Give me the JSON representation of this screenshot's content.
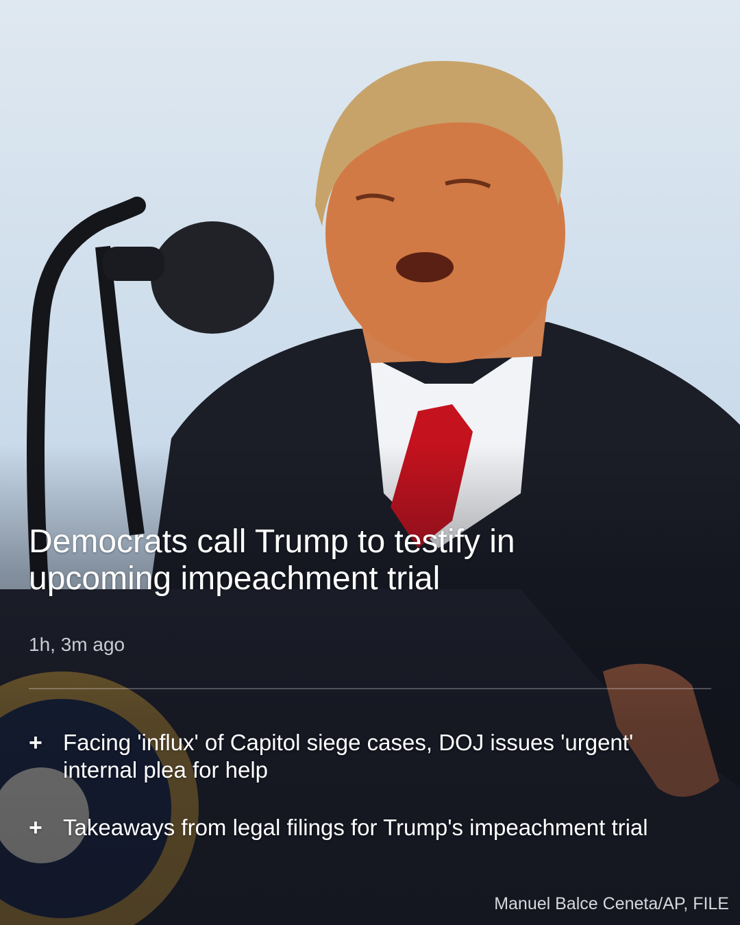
{
  "article": {
    "headline": "Democrats call Trump to testify in upcoming impeachment trial",
    "timestamp": "1h, 3m ago",
    "photo_credit": "Manuel Balce Ceneta/AP, FILE"
  },
  "related": [
    {
      "icon": "plus-icon",
      "label": "Facing 'influx' of Capitol siege cases, DOJ issues 'urgent' internal plea for help"
    },
    {
      "icon": "plus-icon",
      "label": "Takeaways from legal filings for Trump's impeachment trial"
    }
  ],
  "colors": {
    "text": "#ffffff",
    "timestamp": "#c9ccd3",
    "sky": "#cfdeec"
  }
}
